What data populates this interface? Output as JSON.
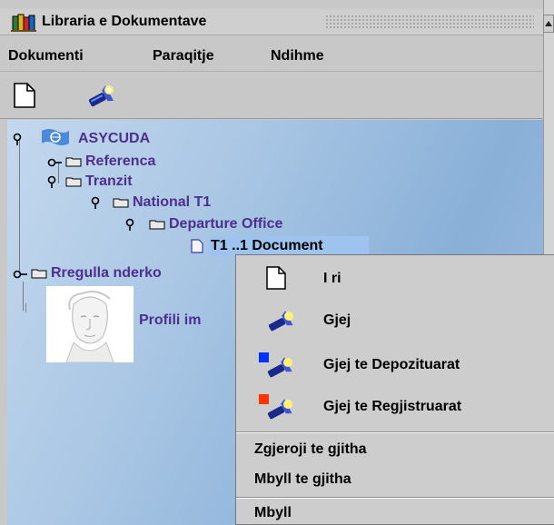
{
  "window": {
    "title": "Libraria e Dokumentave"
  },
  "menubar": {
    "items": [
      "Dokumenti",
      "Paraqitje",
      "Ndihme"
    ]
  },
  "toolbar": {
    "icons": [
      "new-document-icon",
      "flashlight-search-icon"
    ]
  },
  "tree": {
    "root": "ASYCUDA",
    "nodes": [
      {
        "label": "Referenca",
        "expanded": false
      },
      {
        "label": "Tranzit",
        "expanded": true
      },
      {
        "label": "National T1",
        "expanded": true
      },
      {
        "label": "Departure Office",
        "expanded": true
      },
      {
        "label": "T1 ..1 Document",
        "selected": true
      },
      {
        "label": "Rregulla nderko",
        "expanded": false
      }
    ],
    "profile_label": "Profili im"
  },
  "context_menu": {
    "items": [
      {
        "label": "I ri",
        "icon": "new-document-icon"
      },
      {
        "label": "Gjej",
        "icon": "flashlight-search-icon"
      },
      {
        "label": "Gjej te Depozituarat",
        "icon": "stored-search-icon",
        "marker_color": "#0033ff"
      },
      {
        "label": "Gjej te Regjistruarat",
        "icon": "registered-search-icon",
        "marker_color": "#ff3300"
      }
    ],
    "expand_all": "Zgjeroji te gjitha",
    "collapse_all": "Mbyll te gjitha",
    "close": "Mbyll"
  },
  "colors": {
    "tree_text": "#4d2f8e",
    "selection": "#9fc3ef",
    "menu_bg": "#cdcdcd"
  }
}
